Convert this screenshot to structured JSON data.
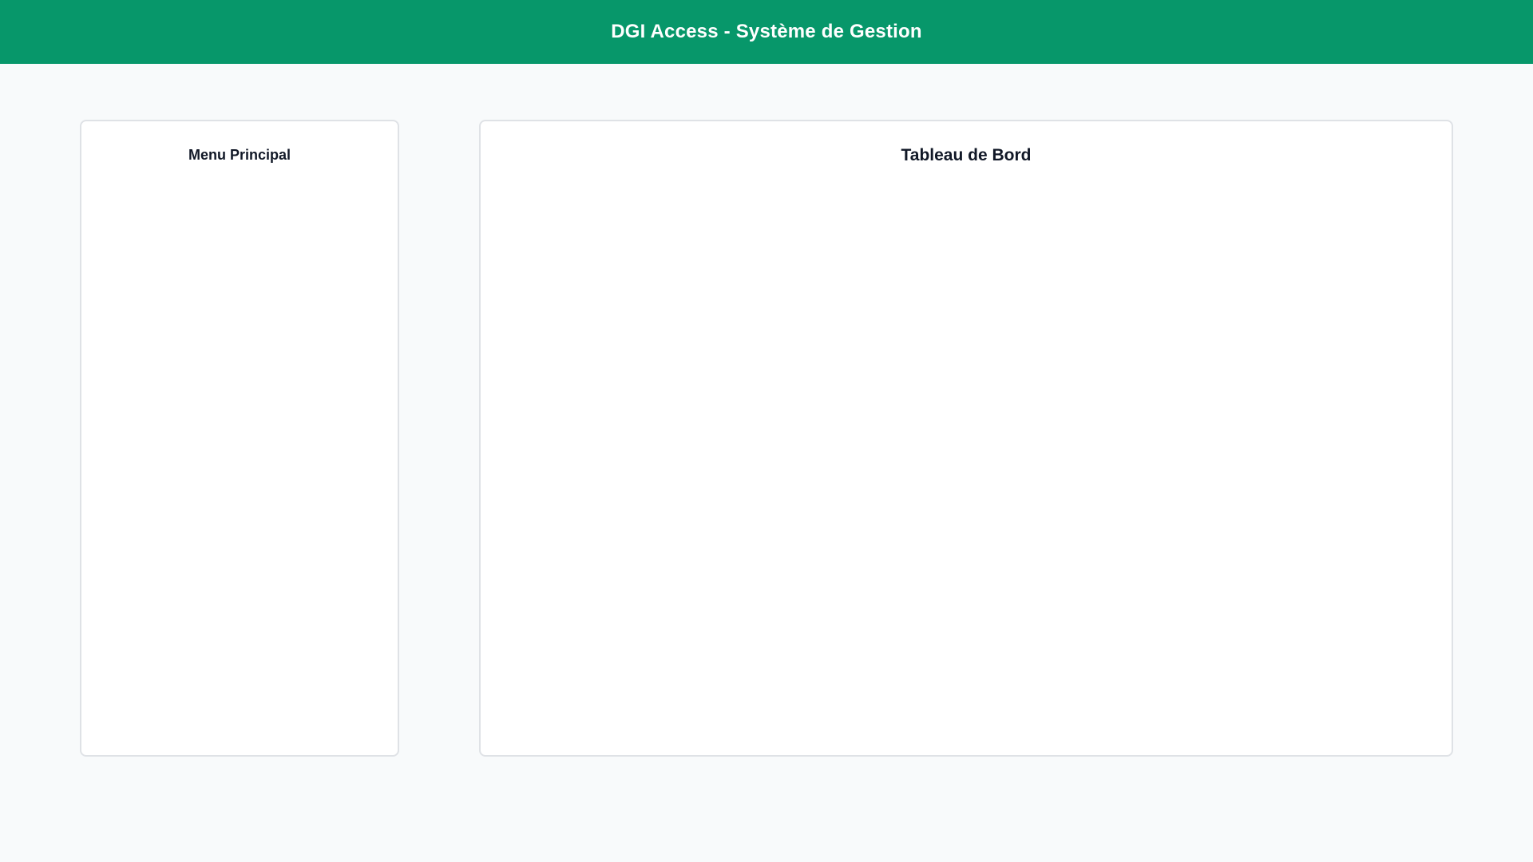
{
  "header": {
    "title": "DGI Access - Système de Gestion"
  },
  "sidebar": {
    "title": "Menu Principal"
  },
  "main": {
    "title": "Tableau de Bord"
  },
  "colors": {
    "header_bg": "#07976a",
    "page_bg": "#f8fafb",
    "panel_bg": "#ffffff",
    "panel_border": "#dfe2e6",
    "title_text": "#111827"
  }
}
